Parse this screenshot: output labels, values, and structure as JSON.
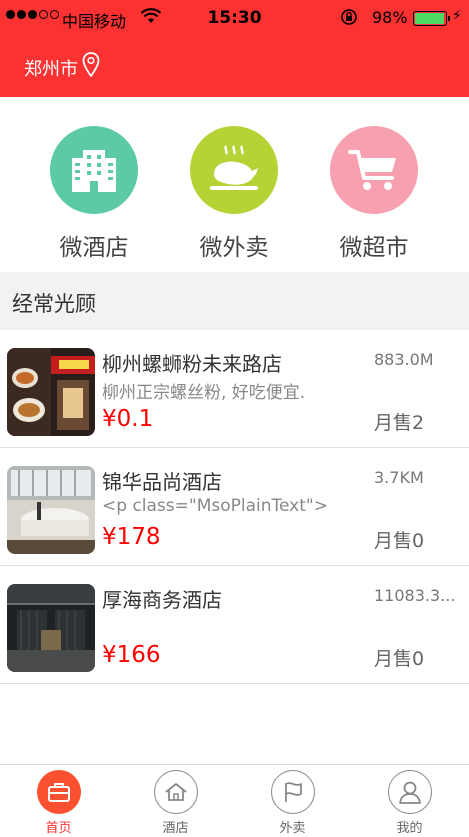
{
  "status_bar": {
    "carrier": "中国移动",
    "time": "15:30",
    "battery_pct": "98%",
    "battery_level": 0.98
  },
  "header": {
    "city": "郑州市",
    "icon": "location-pin-icon",
    "background": "#fc3131"
  },
  "categories": [
    {
      "label": "微酒店",
      "icon": "hotel-building-icon",
      "color": "#5cc9a7"
    },
    {
      "label": "微外卖",
      "icon": "roast-chicken-icon",
      "color": "#b5d334"
    },
    {
      "label": "微超市",
      "icon": "shopping-cart-icon",
      "color": "#f7a0b0"
    }
  ],
  "section": {
    "title": "经常光顾"
  },
  "shops": [
    {
      "name": "柳州螺蛳粉未来路店",
      "desc": "柳州正宗螺丝粉, 好吃便宜.",
      "price": "¥0.1",
      "distance": "883.0M",
      "sales": "月售2"
    },
    {
      "name": "锦华品尚酒店",
      "desc": "<p class=\"MsoPlainText\">",
      "price": "¥178",
      "distance": "3.7KM",
      "sales": "月售0"
    },
    {
      "name": "厚海商务酒店",
      "desc": "",
      "price": "¥166",
      "distance": "11083.3...",
      "sales": "月售0"
    }
  ],
  "tabbar": [
    {
      "label": "首页",
      "icon": "briefcase-icon",
      "active": true
    },
    {
      "label": "酒店",
      "icon": "home-icon",
      "active": false
    },
    {
      "label": "外卖",
      "icon": "flag-icon",
      "active": false
    },
    {
      "label": "我的",
      "icon": "user-icon",
      "active": false
    }
  ],
  "colors": {
    "accent": "#fc3131",
    "price": "#ff0000",
    "tab_active": "#fc5130"
  }
}
